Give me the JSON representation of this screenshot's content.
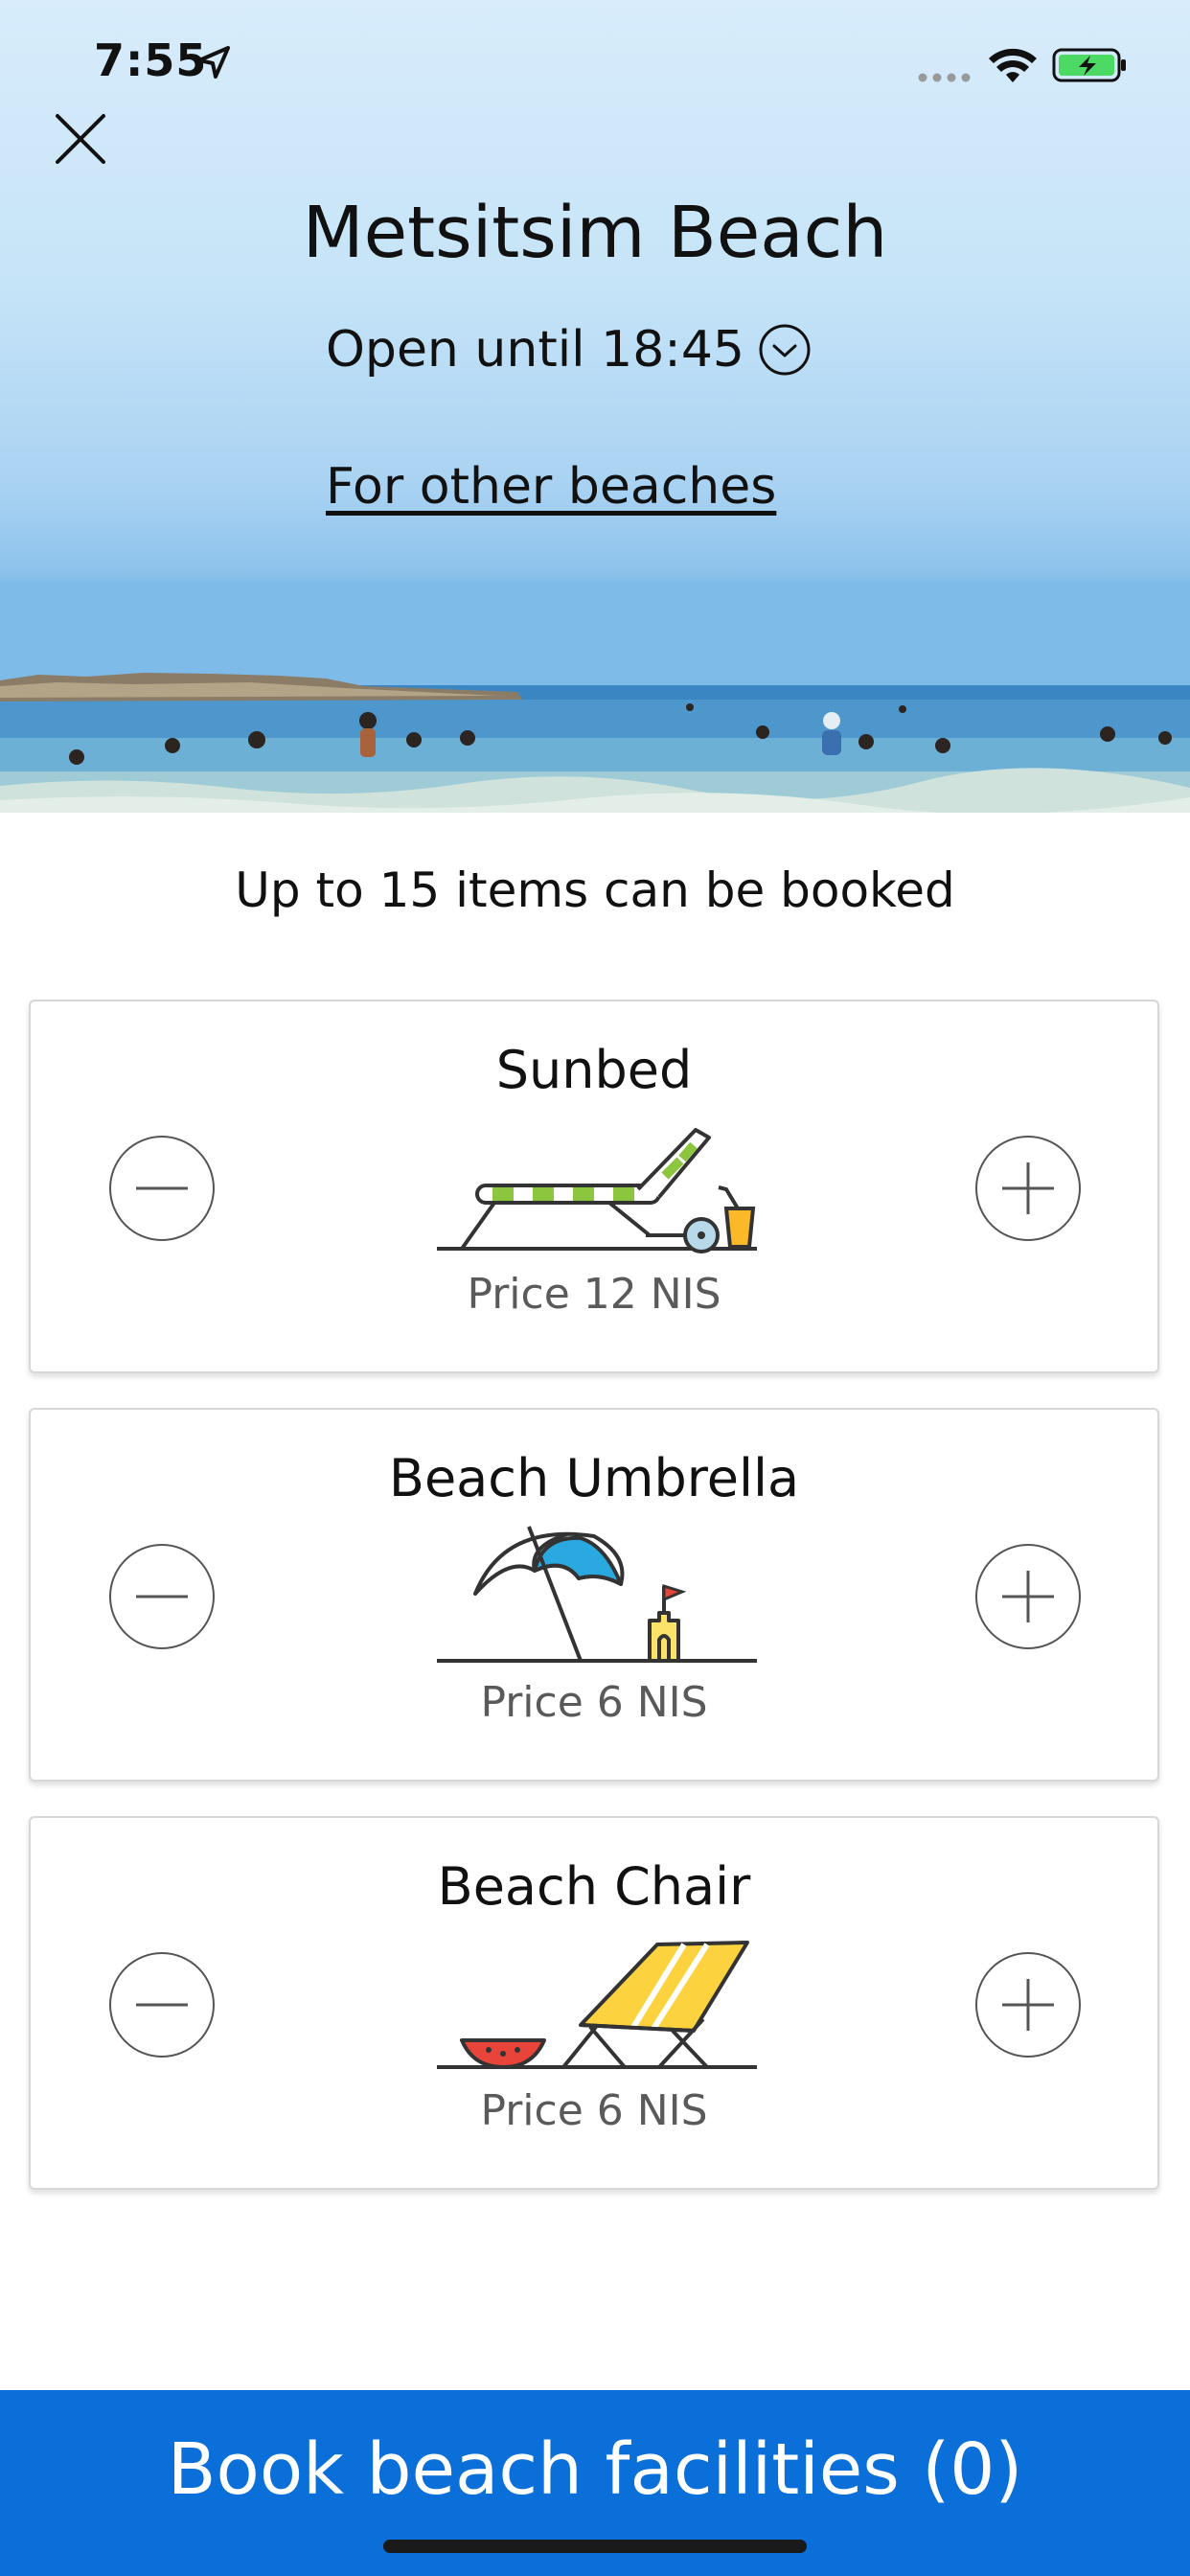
{
  "status_bar": {
    "time": "7:55"
  },
  "header": {
    "title": "Metsitsim Beach",
    "open_until": "Open until 18:45",
    "other_beaches_link": "For other beaches"
  },
  "booking": {
    "limit_text": "Up to 15 items can be booked",
    "items": [
      {
        "name": "Sunbed",
        "price": "Price 12 NIS",
        "icon": "sunbed-icon"
      },
      {
        "name": "Beach Umbrella",
        "price": "Price 6 NIS",
        "icon": "umbrella-icon"
      },
      {
        "name": "Beach Chair",
        "price": "Price 6 NIS",
        "icon": "beach-chair-icon"
      }
    ]
  },
  "footer": {
    "book_button_label": "Book beach facilities (0)"
  },
  "colors": {
    "accent": "#0a6fd8",
    "sky": "#c6e4f8",
    "sea": "#3e8fc4"
  }
}
